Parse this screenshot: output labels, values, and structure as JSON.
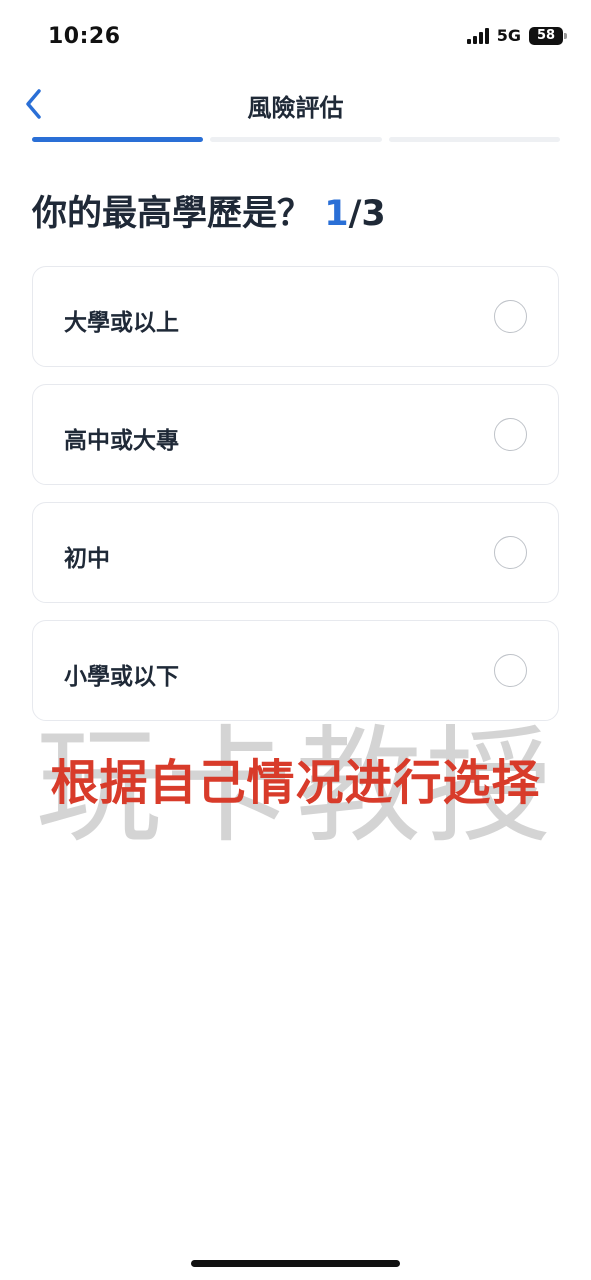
{
  "status_bar": {
    "time": "10:26",
    "network": "5G",
    "battery": "58"
  },
  "header": {
    "title": "風險評估",
    "back_icon": "chevron-left-icon"
  },
  "progress": {
    "current_step": 1,
    "total_steps": 3
  },
  "question": {
    "text": "你的最高學歷是？",
    "step_current": "1",
    "step_separator": "/3"
  },
  "options": [
    {
      "label": "大學或以上"
    },
    {
      "label": "高中或大專"
    },
    {
      "label": "初中"
    },
    {
      "label": "小學或以下"
    }
  ],
  "overlay": {
    "watermark": "玩卡教授",
    "caption": "根据自己情况进行选择"
  },
  "colors": {
    "accent": "#2a6fd6",
    "caption": "#d83b2a"
  }
}
